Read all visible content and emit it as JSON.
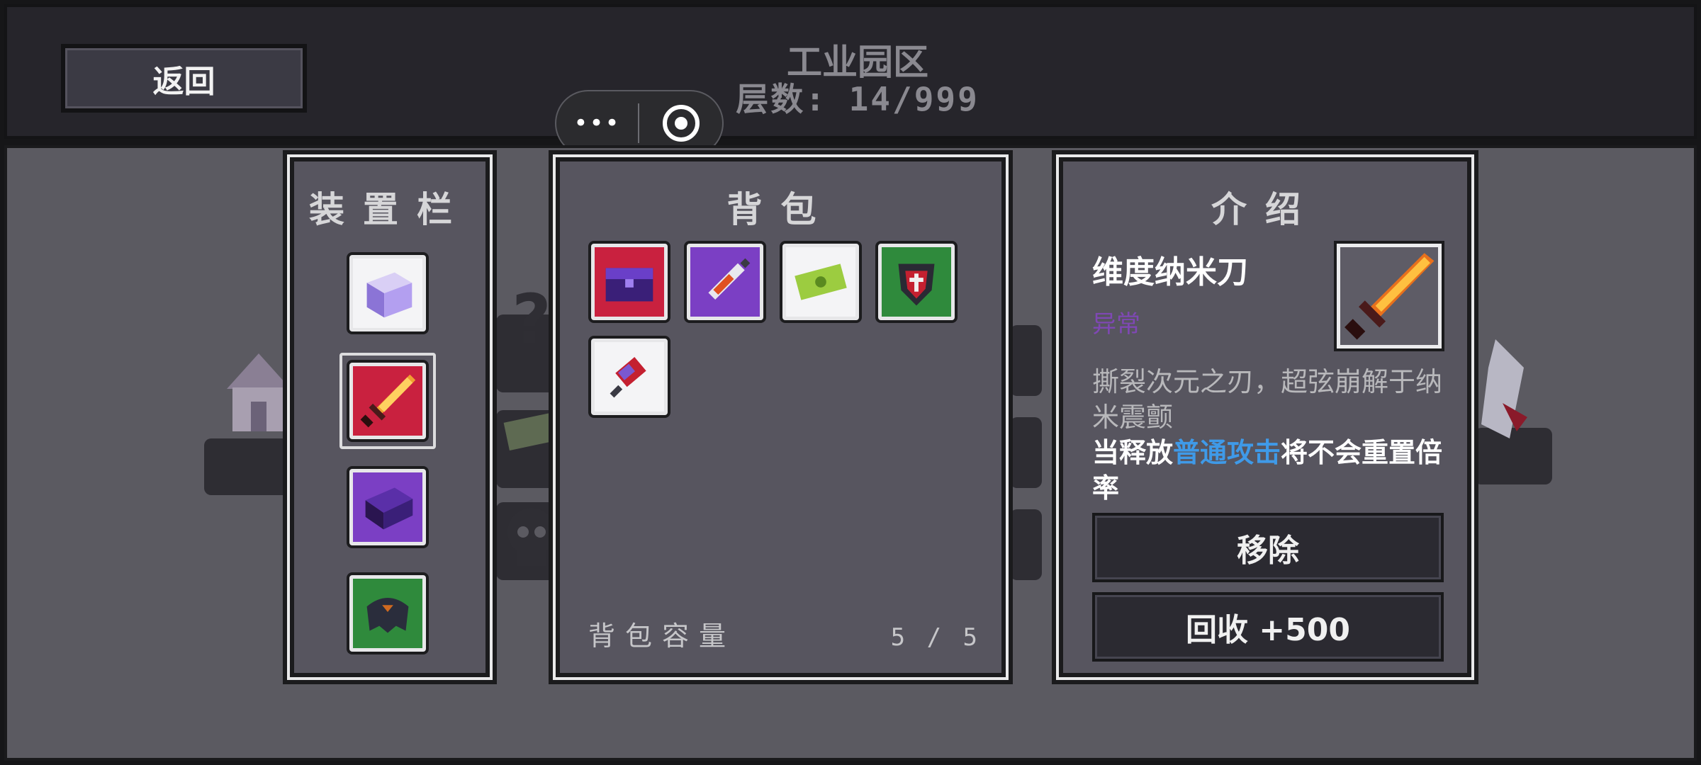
{
  "topbar": {
    "back_label": "返回",
    "level_name": "工业园区",
    "floor_label": "层数:",
    "floor_value": "14/999",
    "mini_more": "•••"
  },
  "equipment_panel": {
    "title": "装置栏",
    "slots": [
      {
        "icon": "crystal-cube-icon",
        "bg": "#f4f4f6"
      },
      {
        "icon": "nano-blade-icon",
        "bg": "#c9213f",
        "selected": true
      },
      {
        "icon": "purple-book-icon",
        "bg": "#7b3fc4"
      },
      {
        "icon": "dark-armor-icon",
        "bg": "#2f8a3c"
      }
    ]
  },
  "backpack_panel": {
    "title": "背包",
    "items": [
      {
        "icon": "purple-chest-icon",
        "bg": "#c9213f"
      },
      {
        "icon": "syringe-icon",
        "bg": "#7b3fc4"
      },
      {
        "icon": "cash-icon",
        "bg": "#f4f4f6"
      },
      {
        "icon": "shield-heart-icon",
        "bg": "#2f8a3c"
      },
      {
        "icon": "rocket-icon",
        "bg": "#f4f4f6"
      }
    ],
    "capacity_label": "背包容量",
    "capacity_value": "5 / 5"
  },
  "info_panel": {
    "title": "介绍",
    "item_name": "维度纳米刀",
    "rarity": "异常",
    "rarity_color": "#7f48b4",
    "description": "撕裂次元之刃，超弦崩解于纳米震颤",
    "effect_prefix": "当释放",
    "effect_keyword": "普通攻击",
    "effect_suffix": "将不会重置倍率",
    "keyword_color": "#3f9ae8",
    "remove_label": "移除",
    "recycle_label": "回收 +500"
  }
}
